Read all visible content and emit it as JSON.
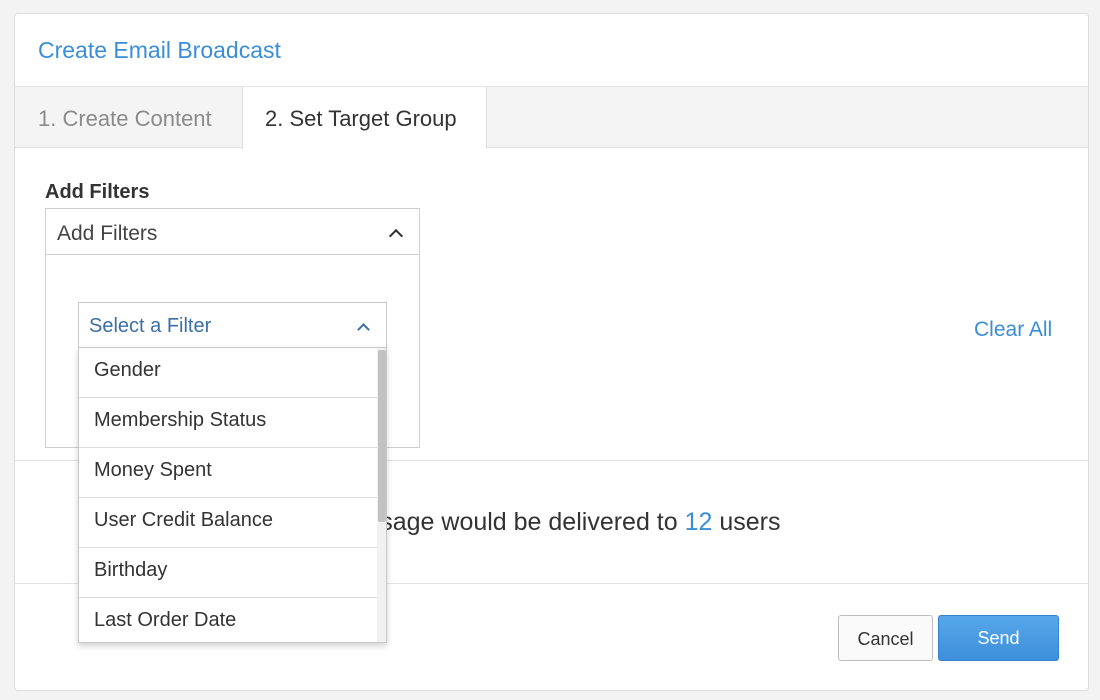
{
  "header": {
    "title": "Create Email Broadcast"
  },
  "tabs": [
    {
      "label": "1. Create Content",
      "active": false
    },
    {
      "label": "2. Set Target Group",
      "active": true
    }
  ],
  "filters": {
    "section_label": "Add Filters",
    "panel_header": "Add Filters",
    "select_placeholder": "Select a Filter",
    "options": [
      "Gender",
      "Membership Status",
      "Money Spent",
      "User Credit Balance",
      "Birthday",
      "Last Order Date"
    ],
    "clear_all_label": "Clear All"
  },
  "delivery": {
    "prefix": "message would be delivered to",
    "count": "12",
    "suffix": "users"
  },
  "actions": {
    "cancel_label": "Cancel",
    "send_label": "Send"
  },
  "colors": {
    "accent": "#3a8ed8",
    "send_button": "#4a9be2",
    "select_text": "#3b6fa5"
  }
}
